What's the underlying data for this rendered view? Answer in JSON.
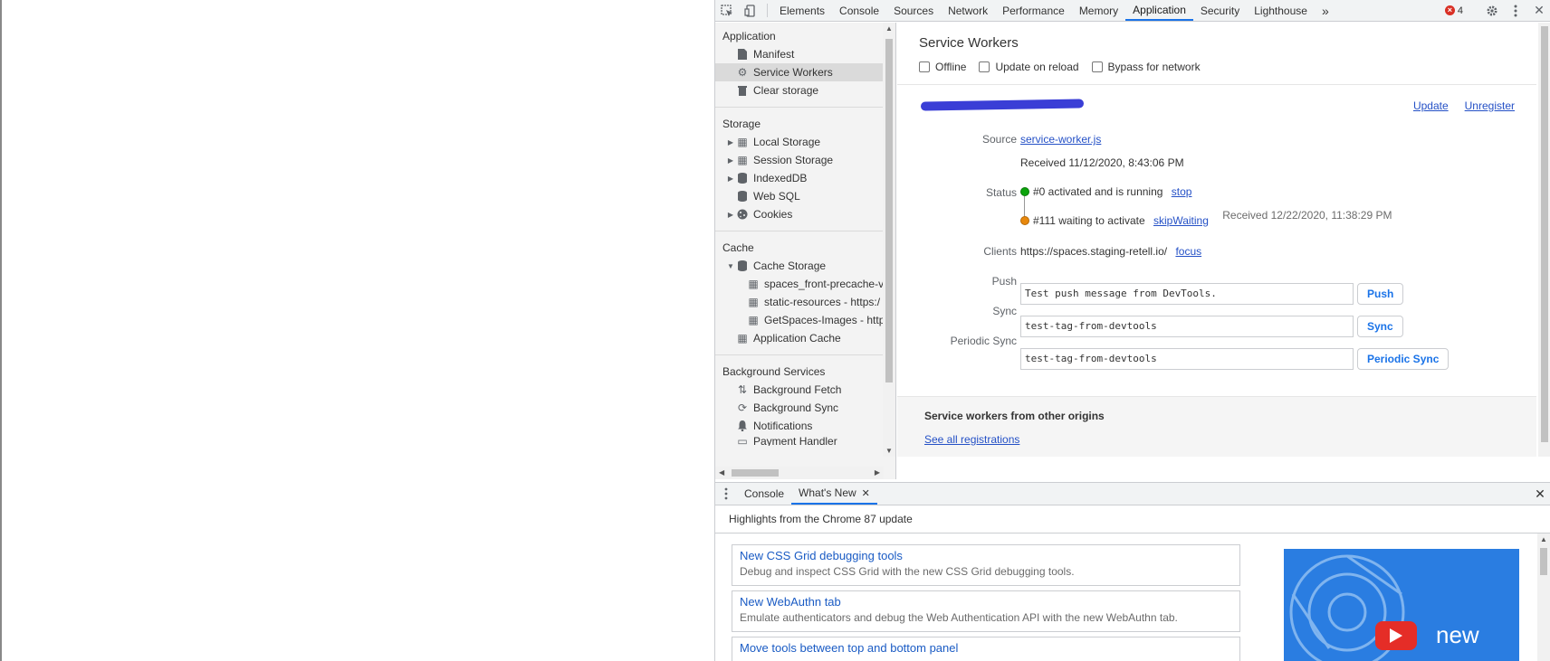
{
  "toolbar": {
    "tabs": [
      "Elements",
      "Console",
      "Sources",
      "Network",
      "Performance",
      "Memory",
      "Application",
      "Security",
      "Lighthouse"
    ],
    "more": "»",
    "error_count": "4"
  },
  "sidebar": {
    "sections": {
      "application": "Application",
      "storage": "Storage",
      "cache": "Cache",
      "background": "Background Services"
    },
    "application_items": [
      "Manifest",
      "Service Workers",
      "Clear storage"
    ],
    "storage_items": [
      "Local Storage",
      "Session Storage",
      "IndexedDB",
      "Web SQL",
      "Cookies"
    ],
    "cache_items": [
      "Cache Storage",
      "spaces_front-precache-v",
      "static-resources - https:/",
      "GetSpaces-Images - http",
      "Application Cache"
    ],
    "background_items": [
      "Background Fetch",
      "Background Sync",
      "Notifications",
      "Payment Handler"
    ]
  },
  "main": {
    "title": "Service Workers",
    "options": [
      "Offline",
      "Update on reload",
      "Bypass for network"
    ],
    "update_link": "Update",
    "unregister_link": "Unregister",
    "source_label": "Source",
    "source_link": "service-worker.js",
    "received": "Received 11/12/2020, 8:43:06 PM",
    "status_label": "Status",
    "status_running": "#0 activated and is running",
    "stop_link": "stop",
    "status_waiting": "#111 waiting to activate",
    "skip_link": "skipWaiting",
    "waiting_received": "Received 12/22/2020, 11:38:29 PM",
    "clients_label": "Clients",
    "clients_value": "https://spaces.staging-retell.io/",
    "focus_link": "focus",
    "push_label": "Push",
    "push_value": "Test push message from DevTools.",
    "push_button": "Push",
    "sync_label": "Sync",
    "sync_value": "test-tag-from-devtools",
    "sync_button": "Sync",
    "periodic_label": "Periodic Sync",
    "periodic_value": "test-tag-from-devtools",
    "periodic_button": "Periodic Sync",
    "other_origins_title": "Service workers from other origins",
    "see_all_link": "See all registrations"
  },
  "drawer": {
    "tabs": [
      "Console",
      "What's New"
    ],
    "highlights": "Highlights from the Chrome 87 update",
    "news": [
      {
        "title": "New CSS Grid debugging tools",
        "desc": "Debug and inspect CSS Grid with the new CSS Grid debugging tools."
      },
      {
        "title": "New WebAuthn tab",
        "desc": "Emulate authenticators and debug the Web Authentication API with the new WebAuthn tab."
      },
      {
        "title": "Move tools between top and bottom panel",
        "desc": ""
      }
    ],
    "video_text": "new"
  },
  "colors": {
    "accent": "#1a73e8",
    "link": "#2450c6",
    "status_running": "#0ca40c",
    "status_waiting": "#e8880c",
    "error": "#d93025"
  }
}
